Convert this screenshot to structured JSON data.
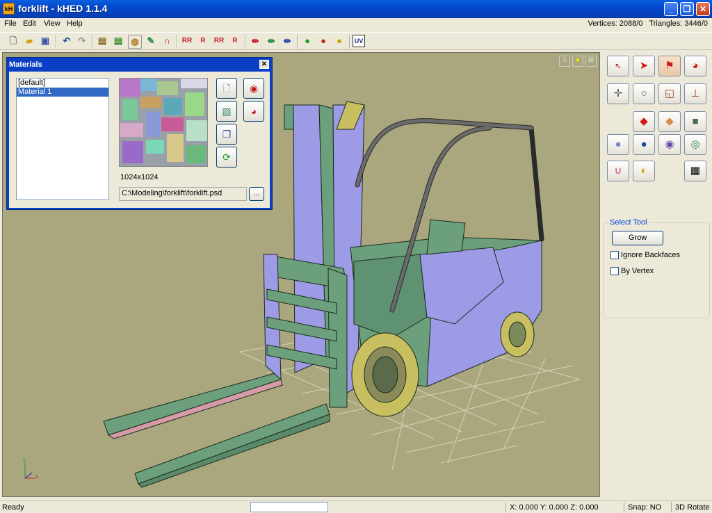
{
  "window": {
    "title": "forklift - kHED 1.1.4",
    "app_icon": "kH"
  },
  "menu": [
    "File",
    "Edit",
    "View",
    "Help"
  ],
  "stats": {
    "vertices": "Vertices: 2088/0",
    "triangles": "Triangles: 3446/0"
  },
  "toolbar": {
    "uv_label": "UV",
    "icons": [
      "new-file-icon",
      "open-folder-icon",
      "save-icon",
      "undo-icon",
      "redo-icon",
      "import-icon",
      "export-icon",
      "palette-icon",
      "wrench-icon",
      "magnet-icon",
      "mirror-x-icon",
      "mirror-y-icon",
      "mirror-z-icon",
      "rotate-icon",
      "weld-x-icon",
      "weld-y-icon",
      "weld-z-icon",
      "green-blob-icon",
      "red-blob-icon",
      "sphere-a-icon",
      "uv-icon"
    ]
  },
  "materials": {
    "title": "Materials",
    "items": [
      "[default]",
      "Material 1"
    ],
    "selected": 1,
    "texture_size": "1024x1024",
    "path": "C:\\Modeling\\forklift\\forklift.psd",
    "browse_label": "..."
  },
  "select_tool": {
    "title": "Select Tool",
    "grow_label": "Grow",
    "ignore_backfaces_label": "Ignore Backfaces",
    "ignore_backfaces_checked": false,
    "by_vertex_label": "By Vertex",
    "by_vertex_checked": false
  },
  "status": {
    "ready": "Ready",
    "coords": "X: 0.000 Y: 0.000 Z: 0.000",
    "snap": "Snap: NO",
    "mode": "3D Rotate",
    "progress": 0
  },
  "colors": {
    "viewport_bg": "#aaa67e",
    "mesh_purple": "#9d9ae6",
    "mesh_green": "#6c9f7c",
    "title_blue": "#0347c9"
  }
}
